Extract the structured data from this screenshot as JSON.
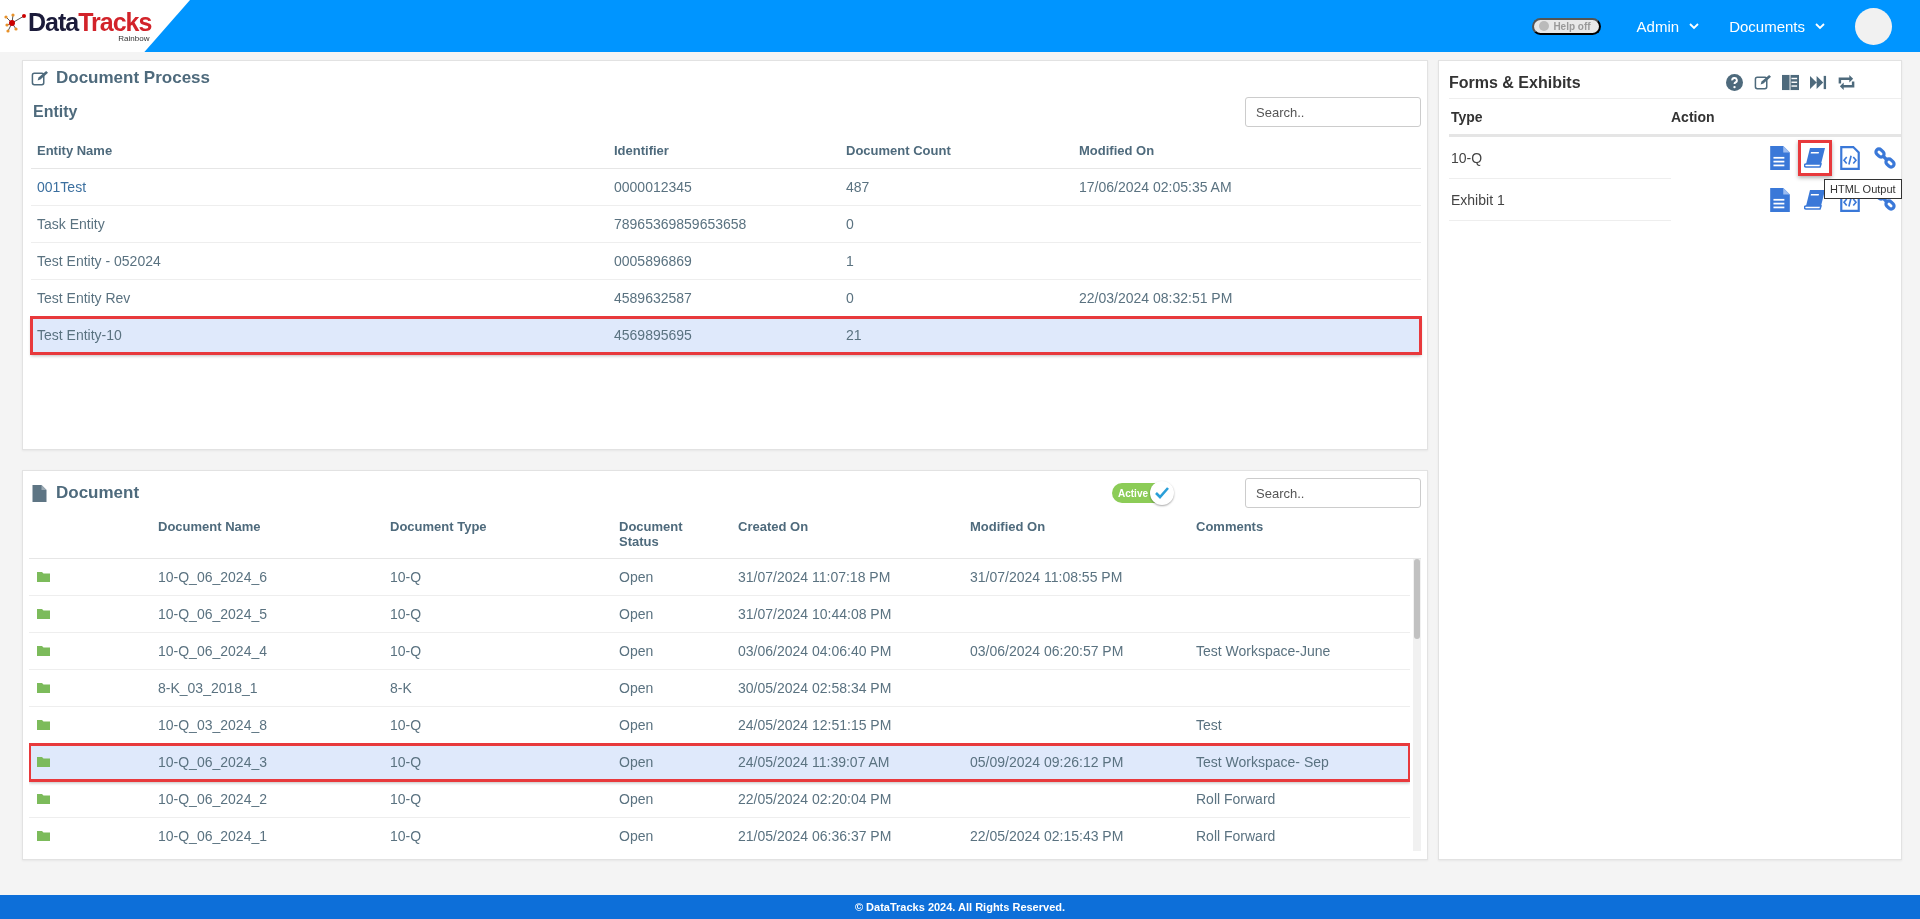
{
  "header": {
    "logo": {
      "primary": "Data",
      "accent": "Tracks",
      "tagline": "Rainbow"
    },
    "help_toggle": {
      "label": "Help off",
      "on": false
    },
    "nav": [
      {
        "label": "Admin"
      },
      {
        "label": "Documents"
      }
    ]
  },
  "document_process": {
    "title": "Document Process",
    "entity": {
      "title": "Entity",
      "search": {
        "placeholder": "Search.."
      },
      "columns": [
        "Entity Name",
        "Identifier",
        "Document Count",
        "Modified On"
      ],
      "rows": [
        {
          "cells": [
            "001Test",
            "0000012345",
            "487",
            "17/06/2024 02:05:35 AM"
          ],
          "selected": false,
          "link": true
        },
        {
          "cells": [
            "Task Entity",
            "78965369859653658",
            "0",
            ""
          ],
          "selected": false,
          "link": false
        },
        {
          "cells": [
            "Test Entity - 052024",
            "0005896869",
            "1",
            ""
          ],
          "selected": false,
          "link": false
        },
        {
          "cells": [
            "Test Entity Rev",
            "4589632587",
            "0",
            "22/03/2024 08:32:51 PM"
          ],
          "selected": false,
          "link": false
        },
        {
          "cells": [
            "Test Entity-10",
            "4569895695",
            "21",
            ""
          ],
          "selected": true,
          "link": false
        }
      ]
    }
  },
  "document": {
    "title": "Document",
    "active_toggle": {
      "label": "Active",
      "on": true
    },
    "search": {
      "placeholder": "Search.."
    },
    "columns": [
      "Document Name",
      "Document Type",
      "Document Status",
      "Created On",
      "Modified On",
      "Comments"
    ],
    "rows": [
      {
        "cells": [
          "10-Q_06_2024_6",
          "10-Q",
          "Open",
          "31/07/2024 11:07:18 PM",
          "31/07/2024 11:08:55 PM",
          ""
        ],
        "selected": false
      },
      {
        "cells": [
          "10-Q_06_2024_5",
          "10-Q",
          "Open",
          "31/07/2024 10:44:08 PM",
          "",
          ""
        ],
        "selected": false
      },
      {
        "cells": [
          "10-Q_06_2024_4",
          "10-Q",
          "Open",
          "03/06/2024 04:06:40 PM",
          "03/06/2024 06:20:57 PM",
          "Test Workspace-June"
        ],
        "selected": false
      },
      {
        "cells": [
          "8-K_03_2018_1",
          "8-K",
          "Open",
          "30/05/2024 02:58:34 PM",
          "",
          ""
        ],
        "selected": false
      },
      {
        "cells": [
          "10-Q_03_2024_8",
          "10-Q",
          "Open",
          "24/05/2024 12:51:15 PM",
          "",
          "Test"
        ],
        "selected": false
      },
      {
        "cells": [
          "10-Q_06_2024_3",
          "10-Q",
          "Open",
          "24/05/2024 11:39:07 AM",
          "05/09/2024 09:26:12 PM",
          "Test Workspace- Sep"
        ],
        "selected": true
      },
      {
        "cells": [
          "10-Q_06_2024_2",
          "10-Q",
          "Open",
          "22/05/2024 02:20:04 PM",
          "",
          "Roll Forward"
        ],
        "selected": false
      },
      {
        "cells": [
          "10-Q_06_2024_1",
          "10-Q",
          "Open",
          "21/05/2024 06:36:37 PM",
          "22/05/2024 02:15:43 PM",
          "Roll Forward"
        ],
        "selected": false
      }
    ]
  },
  "forms_exhibits": {
    "title": "Forms & Exhibits",
    "columns": [
      "Type",
      "Action"
    ],
    "rows": [
      {
        "type": "10-Q",
        "actions": [
          {
            "kind": "document",
            "highlighted": false
          },
          {
            "kind": "book",
            "highlighted": true,
            "tooltip": "HTML Output"
          },
          {
            "kind": "code",
            "highlighted": false
          },
          {
            "kind": "link",
            "highlighted": false
          }
        ]
      },
      {
        "type": "Exhibit 1",
        "actions": [
          {
            "kind": "document",
            "highlighted": false
          },
          {
            "kind": "book",
            "highlighted": false
          },
          {
            "kind": "code",
            "highlighted": false
          },
          {
            "kind": "link",
            "highlighted": false
          }
        ]
      }
    ]
  },
  "footer": {
    "text": "© DataTracks 2024. All Rights Reserved."
  }
}
